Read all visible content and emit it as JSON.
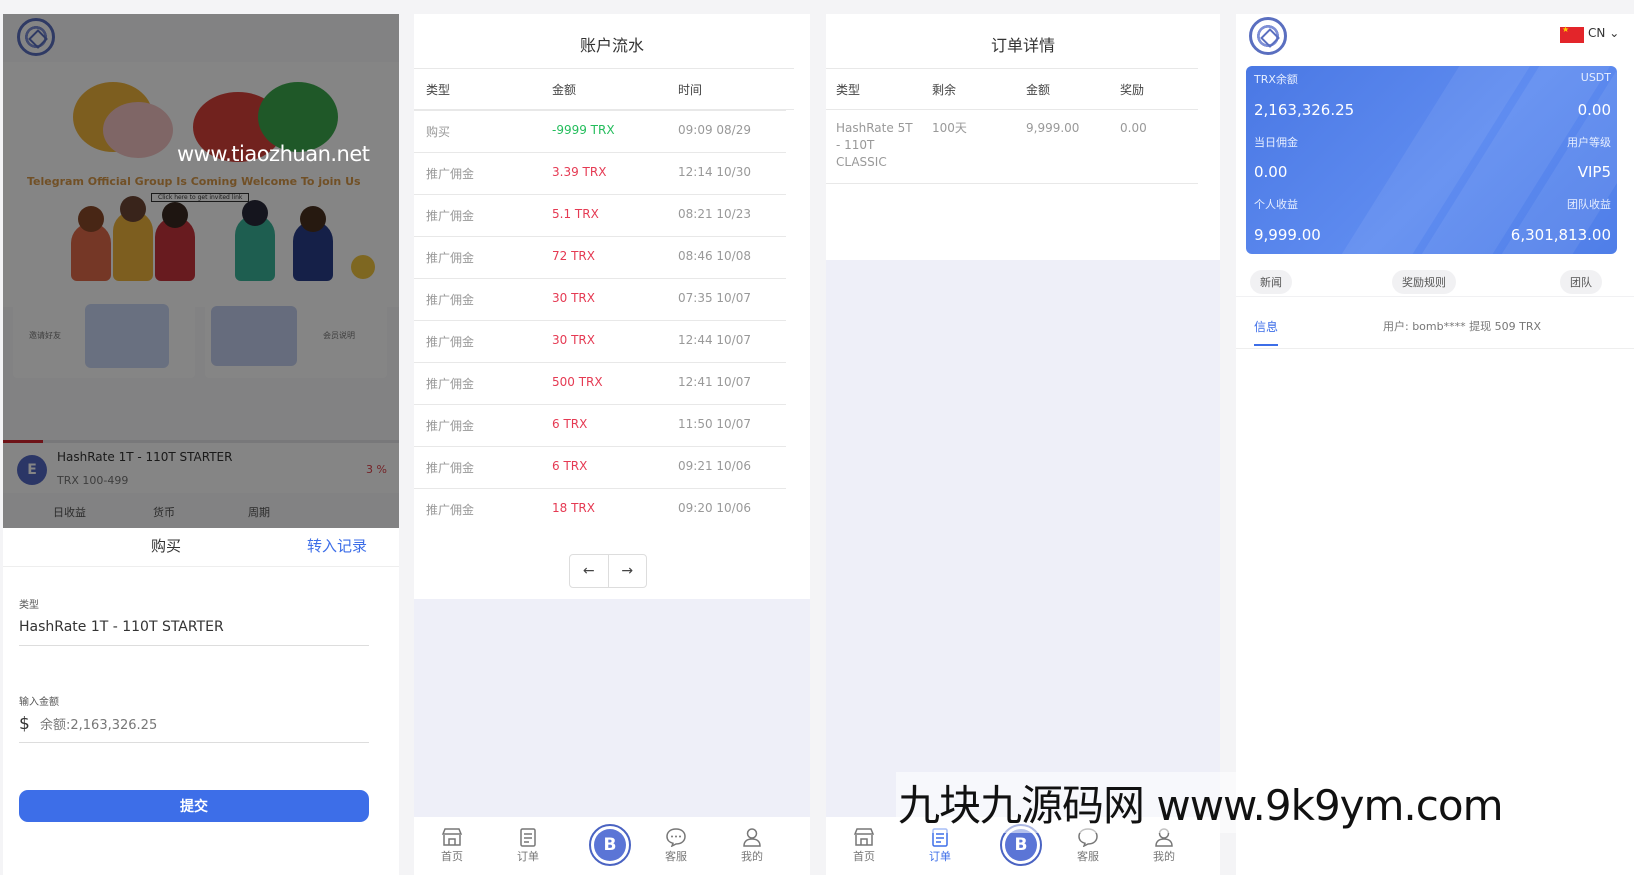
{
  "watermarks": {
    "top_site": "www.tiaozhuan.net",
    "bottom_brand": "九块九源码网 www.9k9ym.com"
  },
  "home": {
    "banner_title": "Telegram Official Group  Is Coming Welcome To join Us",
    "banner_link": "Click here to get invited link",
    "card_left_label": "邀请好友",
    "card_right_label": "会员说明",
    "product": {
      "icon_letter": "E",
      "name": "HashRate 1T - 110T STARTER",
      "range": "TRX 100-499",
      "pct": "3 %",
      "progress_fraction": 0.1
    },
    "product_columns": [
      "日收益",
      "货币",
      "周期"
    ]
  },
  "buy_sheet": {
    "tab_buy": "购买",
    "tab_records": "转入记录",
    "type_label": "类型",
    "type_value": "HashRate 1T - 110T STARTER",
    "amount_label": "输入金额",
    "currency_symbol": "$",
    "amount_placeholder": "余额:2,163,326.25",
    "submit": "提交"
  },
  "ledger": {
    "title": "账户流水",
    "headers": [
      "类型",
      "金额",
      "时间"
    ],
    "rows": [
      {
        "type": "购买",
        "amount": "-9999 TRX",
        "time": "09:09 08/29"
      },
      {
        "type": "推广佣金",
        "amount": "3.39 TRX",
        "time": "12:14 10/30"
      },
      {
        "type": "推广佣金",
        "amount": "5.1 TRX",
        "time": "08:21 10/23"
      },
      {
        "type": "推广佣金",
        "amount": "72 TRX",
        "time": "08:46 10/08"
      },
      {
        "type": "推广佣金",
        "amount": "30 TRX",
        "time": "07:35 10/07"
      },
      {
        "type": "推广佣金",
        "amount": "30 TRX",
        "time": "12:44 10/07"
      },
      {
        "type": "推广佣金",
        "amount": "500 TRX",
        "time": "12:41 10/07"
      },
      {
        "type": "推广佣金",
        "amount": "6 TRX",
        "time": "11:50 10/07"
      },
      {
        "type": "推广佣金",
        "amount": "6 TRX",
        "time": "09:21 10/06"
      },
      {
        "type": "推广佣金",
        "amount": "18 TRX",
        "time": "09:20 10/06"
      }
    ],
    "prev": "←",
    "next": "→"
  },
  "orders": {
    "title": "订单详情",
    "headers": [
      "类型",
      "剩余",
      "金额",
      "奖励"
    ],
    "row": {
      "type_lines": [
        "HashRate 5T",
        "- 110T",
        "CLASSIC"
      ],
      "remaining": "100天",
      "amount": "9,999.00",
      "reward": "0.00"
    }
  },
  "nav": {
    "home": "首页",
    "orders": "订单",
    "center": "B",
    "service": "客服",
    "mine": "我的",
    "icons": [
      "store-icon",
      "clipboard-icon",
      "bitcoin-icon",
      "chat-icon",
      "user-icon"
    ]
  },
  "account": {
    "lang": "CN",
    "flag": "china-flag",
    "trx_balance_label": "TRX余额",
    "usdt_label": "USDT",
    "trx_balance": "2,163,326.25",
    "usdt_balance": "0.00",
    "today_commission_label": "当日佣金",
    "user_level_label": "用户等级",
    "today_commission": "0.00",
    "user_level": "VIP5",
    "personal_income_label": "个人收益",
    "team_income_label": "团队收益",
    "personal_income": "9,999.00",
    "team_income": "6,301,813.00",
    "quick_news": "新闻",
    "quick_rules": "奖励规则",
    "quick_team": "团队",
    "notice_tag": "信息",
    "notice_text": "用户: bomb**** 提现 509 TRX"
  },
  "colors": {
    "accent": "#3d6ee8",
    "positive_amount": "#e53a53",
    "negative_amount": "#24bd5c"
  }
}
